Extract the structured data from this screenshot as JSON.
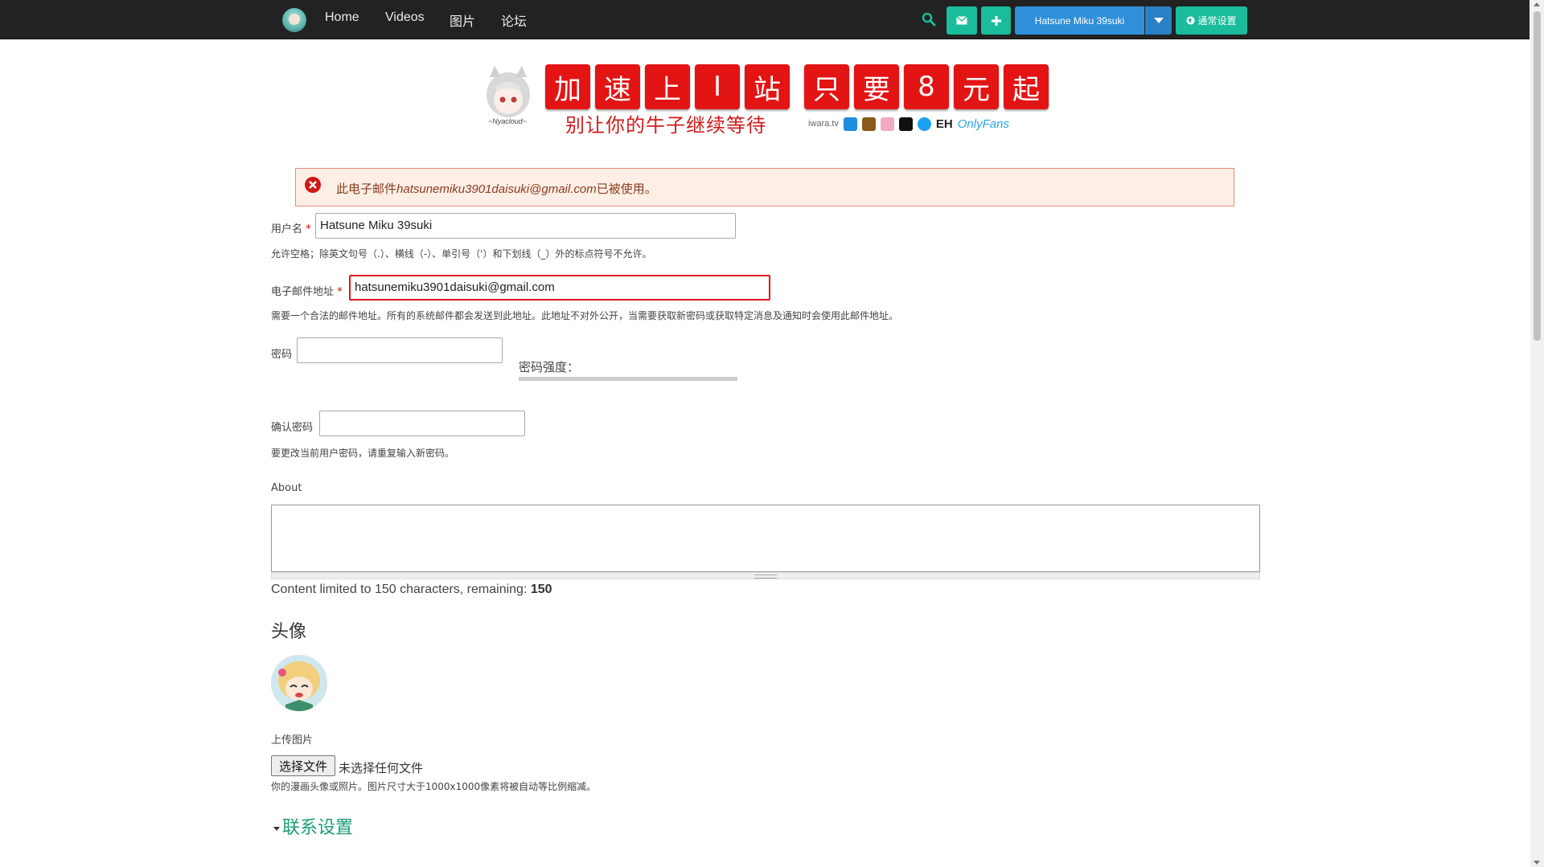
{
  "nav": {
    "links": [
      "Home",
      "Videos",
      "图片",
      "论坛"
    ],
    "username": "Hatsune Miku 39suki",
    "settings": "通常设置"
  },
  "banner": {
    "chars": [
      "加",
      "速",
      "上",
      "I",
      "站",
      "只",
      "要",
      "8",
      "元",
      "起"
    ],
    "subtitle": "别让你的牛子继续等待",
    "logo_text": "~Nyacloud~",
    "partner_text": [
      "iwara.tv",
      "EH",
      "OnlyFans"
    ]
  },
  "alert": {
    "prefix": "此电子邮件",
    "email": "hatsunemiku3901daisuki@gmail.com",
    "suffix": "已被使用。"
  },
  "form": {
    "username_label": "用户名",
    "username_value": "Hatsune Miku 39suki",
    "username_help": "允许空格；除英文句号（.）、横线（-）、单引号（'）和下划线（_）外的标点符号不允许。",
    "email_label": "电子邮件地址",
    "email_value": "hatsunemiku3901daisuki@gmail.com",
    "email_help": "需要一个合法的邮件地址。所有的系统邮件都会发送到此地址。此地址不对外公开，当需要获取新密码或获取特定消息及通知时会使用此邮件地址。",
    "password_label": "密码",
    "strength_label": "密码强度：",
    "confirm_label": "确认密码",
    "confirm_help": "要更改当前用户密码，请重复输入新密码。",
    "about_label": "About",
    "limit_text": "Content limited to 150 characters, remaining:",
    "limit_remaining": "150",
    "required_mark": "*"
  },
  "avatar_section": {
    "title": "头像",
    "upload_label": "上传图片",
    "file_button": "选择文件",
    "file_none": "未选择任何文件",
    "help": "你的漫画头像或照片。图片尺寸大于1000x1000像素将被自动等比例缩减。"
  },
  "contact": {
    "title": "联系设置"
  },
  "colors": {
    "accent": "#1abc9c",
    "primary": "#2f8fd8",
    "error": "#e0161c",
    "banner_red": "#e31414"
  }
}
